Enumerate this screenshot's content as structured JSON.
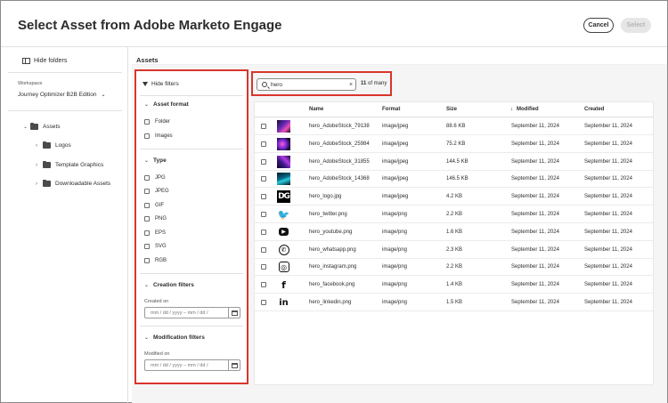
{
  "dialog": {
    "title": "Select Asset from Adobe Marketo Engage",
    "cancel_label": "Cancel",
    "select_label": "Select"
  },
  "sidebar": {
    "hide_folders_label": "Hide folders",
    "workspace_label": "Workspace",
    "workspace_value": "Journey Optimizer B2B Edition",
    "tree": [
      {
        "label": "Assets",
        "expanded": true
      },
      {
        "label": "Logos"
      },
      {
        "label": "Template Graphics"
      },
      {
        "label": "Downloadable Assets"
      }
    ]
  },
  "main": {
    "heading": "Assets"
  },
  "filters": {
    "hide_filters_label": "Hide filters",
    "asset_format": {
      "title": "Asset format",
      "options": [
        "Folder",
        "Images"
      ]
    },
    "type": {
      "title": "Type",
      "options": [
        "JPG",
        "JPEG",
        "GIF",
        "PNG",
        "EPS",
        "SVG",
        "RGB"
      ]
    },
    "creation": {
      "title": "Creation filters",
      "label": "Created on",
      "placeholder": "mm / dd / yyyy  –  mm / dd /"
    },
    "modification": {
      "title": "Modification filters",
      "label": "Modified on",
      "placeholder": "mm / dd / yyyy  –  mm / dd /"
    }
  },
  "search": {
    "query": "hero",
    "count_number": "11",
    "count_suffix": "of many"
  },
  "table": {
    "columns": {
      "name": "Name",
      "format": "Format",
      "size": "Size",
      "modified": "Modified",
      "created": "Created",
      "sort_indicator": "↓"
    },
    "rows": [
      {
        "thumb": "photo1",
        "name": "hero_AdobeStock_79138",
        "format": "image/jpeg",
        "size": "88.6 KB",
        "modified": "September 11, 2024",
        "created": "September 11, 2024"
      },
      {
        "thumb": "photo2",
        "name": "hero_AdobeStock_25984",
        "format": "image/jpeg",
        "size": "75.2 KB",
        "modified": "September 11, 2024",
        "created": "September 11, 2024"
      },
      {
        "thumb": "photo3",
        "name": "hero_AdobeStock_31855",
        "format": "image/jpeg",
        "size": "144.5 KB",
        "modified": "September 11, 2024",
        "created": "September 11, 2024"
      },
      {
        "thumb": "photo4",
        "name": "hero_AdobeStock_14368",
        "format": "image/jpeg",
        "size": "146.5 KB",
        "modified": "September 11, 2024",
        "created": "September 11, 2024"
      },
      {
        "thumb": "logo",
        "name": "hero_logo.jpg",
        "format": "image/jpeg",
        "size": "4.2 KB",
        "modified": "September 11, 2024",
        "created": "September 11, 2024"
      },
      {
        "thumb": "twitter",
        "name": "hero_twitter.png",
        "format": "image/png",
        "size": "2.2 KB",
        "modified": "September 11, 2024",
        "created": "September 11, 2024"
      },
      {
        "thumb": "youtube",
        "name": "hero_youtube.png",
        "format": "image/png",
        "size": "1.6 KB",
        "modified": "September 11, 2024",
        "created": "September 11, 2024"
      },
      {
        "thumb": "whatsapp",
        "name": "hero_whatsapp.png",
        "format": "image/png",
        "size": "2.3 KB",
        "modified": "September 11, 2024",
        "created": "September 11, 2024"
      },
      {
        "thumb": "instagram",
        "name": "hero_instagram.png",
        "format": "image/png",
        "size": "2.2 KB",
        "modified": "September 11, 2024",
        "created": "September 11, 2024"
      },
      {
        "thumb": "facebook",
        "name": "hero_facebook.png",
        "format": "image/png",
        "size": "1.4 KB",
        "modified": "September 11, 2024",
        "created": "September 11, 2024"
      },
      {
        "thumb": "linkedin",
        "name": "hero_linkedin.png",
        "format": "image/png",
        "size": "1.5 KB",
        "modified": "September 11, 2024",
        "created": "September 11, 2024"
      }
    ]
  },
  "logo_thumb_text": "DG",
  "colors": {
    "highlight": "#d9352c",
    "accent_text": "#2c2c2c",
    "panel_bg": "#f5f5f5"
  }
}
